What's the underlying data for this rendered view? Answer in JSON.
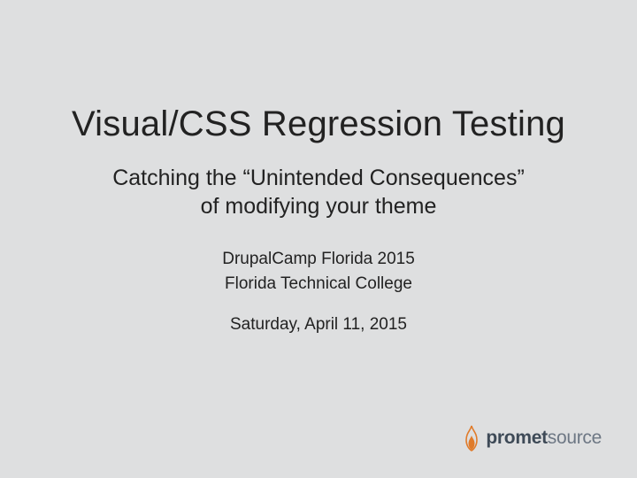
{
  "title": "Visual/CSS Regression Testing",
  "subtitle_line1": "Catching the “Unintended Consequences”",
  "subtitle_line2": "of modifying your theme",
  "event": "DrupalCamp Florida 2015",
  "venue": "Florida Technical College",
  "date": "Saturday, April 11, 2015",
  "logo": {
    "word1": "promet",
    "word2": "source",
    "flame_color": "#e07b2a"
  }
}
